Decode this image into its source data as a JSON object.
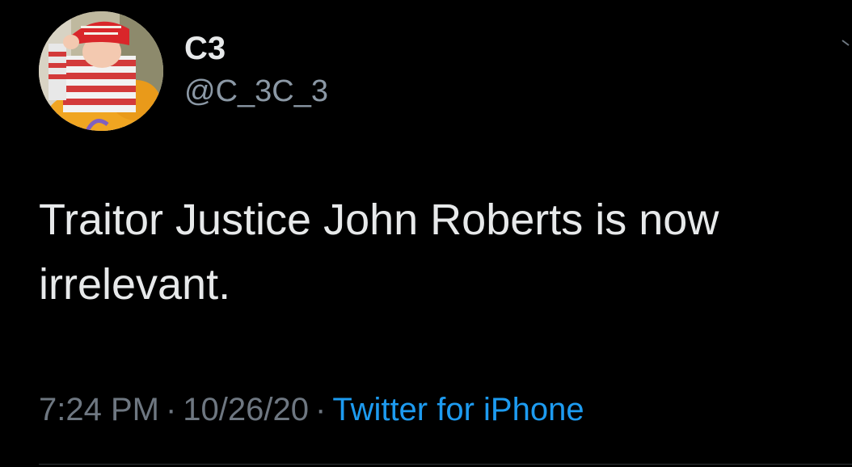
{
  "user": {
    "display_name": "C3",
    "handle": "@C_3C_3",
    "avatar_icon": "avatar-photo"
  },
  "tweet": {
    "text": "Traitor Justice John Roberts is now irrelevant."
  },
  "meta": {
    "time": "7:24 PM",
    "separator": "·",
    "date": "10/26/20",
    "source": "Twitter for iPhone"
  },
  "colors": {
    "background": "#000000",
    "primary_text": "#e7e9ea",
    "secondary_text": "#8b98a5",
    "link": "#1d9bf0"
  }
}
